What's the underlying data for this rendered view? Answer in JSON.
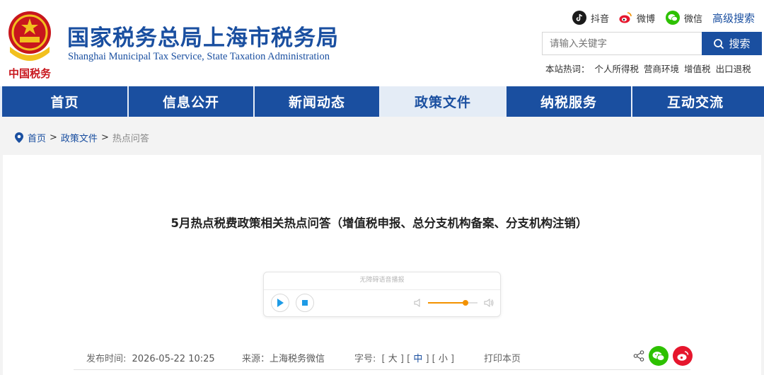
{
  "header": {
    "title": "国家税务总局上海市税务局",
    "subtitle": "Shanghai Municipal Tax Service, State Taxation Administration",
    "social": [
      {
        "icon": "douyin-icon",
        "label": "抖音",
        "color": "#1a1a1a"
      },
      {
        "icon": "weibo-icon",
        "label": "微博",
        "color": "#e6162d"
      },
      {
        "icon": "wechat-icon",
        "label": "微信",
        "color": "#2dc100"
      }
    ],
    "advanced_search": "高级搜索",
    "search": {
      "placeholder": "请输入关键字",
      "button_label": "搜索"
    },
    "hot_label": "本站热词：",
    "hot_words": [
      "个人所得税",
      "营商环境",
      "增值税",
      "出口退税"
    ]
  },
  "nav": {
    "items": [
      "首页",
      "信息公开",
      "新闻动态",
      "政策文件",
      "纳税服务",
      "互动交流"
    ],
    "active_index": 3,
    "accent": "#1a4fa0"
  },
  "breadcrumb": {
    "items": [
      "首页",
      "政策文件",
      "热点问答"
    ],
    "separator": ">"
  },
  "article": {
    "title": "5月热点税费政策相关热点问答（增值税申报、总分支机构备案、分支机构注销）",
    "player": {
      "label": "无障碍语音播报",
      "volume": 0.75
    },
    "meta": {
      "date_label": "发布时间:",
      "date": "2026-05-22 10:25",
      "source_label": "来源：",
      "source": "上海税务微信",
      "font_label": "字号:",
      "font_options": [
        "大",
        "中",
        "小"
      ],
      "font_selected": "中",
      "print": "打印本页"
    }
  }
}
